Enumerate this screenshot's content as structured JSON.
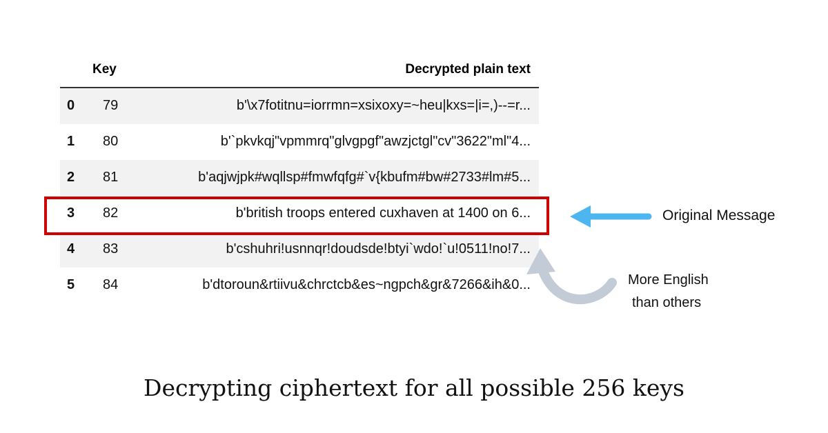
{
  "table": {
    "headers": {
      "key": "Key",
      "text": "Decrypted plain text"
    },
    "rows": [
      {
        "index": "0",
        "key": "79",
        "text": "b'\\x7fotitnu=iorrmn=xsixoxy=~heu|kxs=|i=,)--=r..."
      },
      {
        "index": "1",
        "key": "80",
        "text": "b'`pkvkqj\"vpmmrq\"glvgpgf\"awzjctgl\"cv\"3622\"ml\"4..."
      },
      {
        "index": "2",
        "key": "81",
        "text": "b'aqjwjpk#wqllsp#fmwfqfg#`v{kbufm#bw#2733#lm#5..."
      },
      {
        "index": "3",
        "key": "82",
        "text": "b'british troops entered cuxhaven at 1400 on 6..."
      },
      {
        "index": "4",
        "key": "83",
        "text": "b'cshuhri!usnnqr!doudsde!btyi`wdo!`u!0511!no!7..."
      },
      {
        "index": "5",
        "key": "84",
        "text": "b'dtoroun&rtiivu&chrctcb&es~ngpch&gr&7266&ih&0..."
      }
    ]
  },
  "annotations": {
    "original": "Original Message",
    "more_english_1": "More English",
    "more_english_2": "than others"
  },
  "caption": "Decrypting ciphertext for all possible 256 keys",
  "colors": {
    "highlight": "#d10000",
    "arrow_blue": "#4db6f0",
    "arrow_gray": "#c3ccd6"
  }
}
